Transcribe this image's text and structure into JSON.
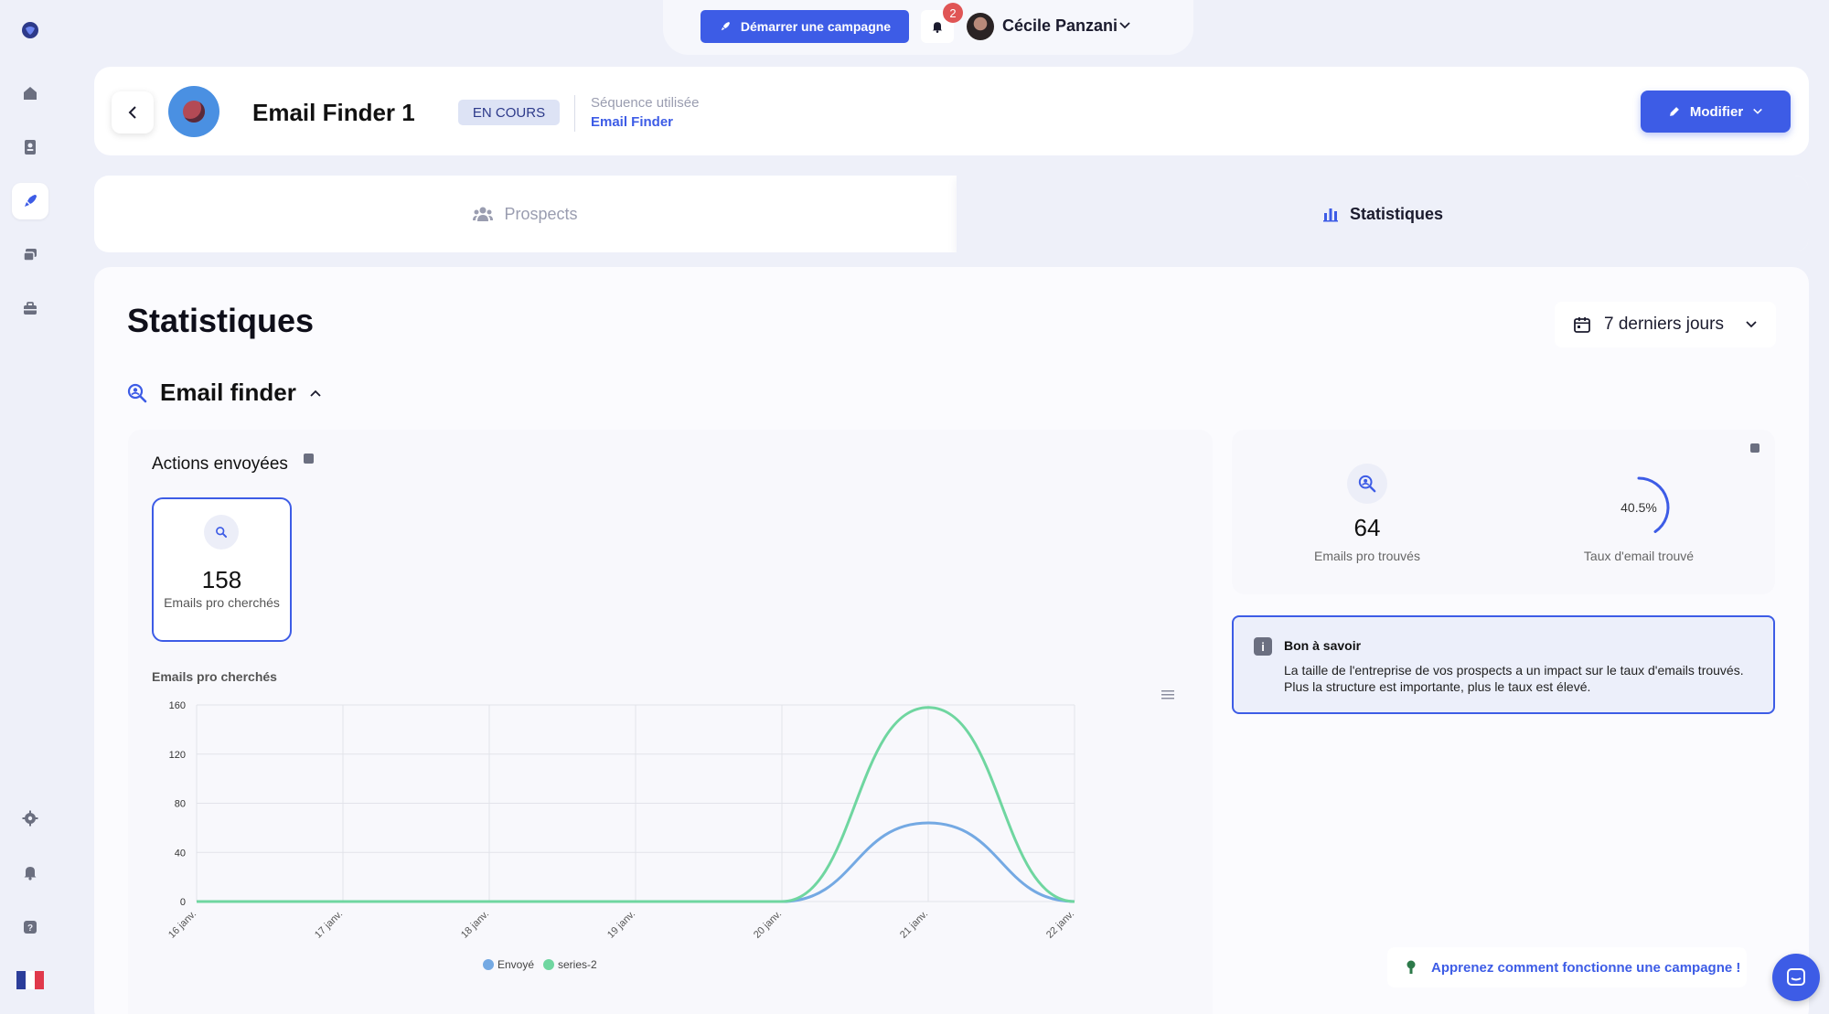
{
  "topbar": {
    "start_campaign_label": "Démarrer une campagne",
    "notification_count": "2",
    "user_name": "Cécile Panzani"
  },
  "sidebar": {
    "items": [
      {
        "icon": "logo-icon"
      },
      {
        "icon": "home-icon"
      },
      {
        "icon": "contacts-icon"
      },
      {
        "icon": "rocket-icon",
        "active": true
      },
      {
        "icon": "chat-icon"
      },
      {
        "icon": "briefcase-icon"
      },
      {
        "icon": "gear-icon"
      },
      {
        "icon": "bell-icon"
      },
      {
        "icon": "help-icon"
      },
      {
        "icon": "french-flag-icon"
      }
    ]
  },
  "header": {
    "title": "Email Finder 1",
    "status": "EN COURS",
    "sequence_label": "Séquence utilisée",
    "sequence_name": "Email Finder",
    "edit_label": "Modifier"
  },
  "tabs": [
    {
      "label": "Prospects",
      "active": false
    },
    {
      "label": "Statistiques",
      "active": true
    }
  ],
  "main": {
    "title": "Statistiques",
    "period": "7 derniers jours",
    "section_title": "Email finder",
    "actions_title": "Actions envoyées",
    "stat_box": {
      "value": "158",
      "label": "Emails pro cherchés"
    },
    "chart_label": "Emails pro cherchés"
  },
  "kpis": {
    "found_value": "64",
    "found_label": "Emails pro trouvés",
    "rate_value": "40.5%",
    "rate_label": "Taux d'email trouvé",
    "rate_fraction": 0.405
  },
  "tip": {
    "title": "Bon à savoir",
    "text": "La taille de l'entreprise de vos prospects a un impact sur le taux d'emails trouvés. Plus la structure est importante, plus le taux est élevé."
  },
  "learn_link": "Apprenez comment fonctionne une campagne !",
  "colors": {
    "accent": "#3d5ce6",
    "series_1": "#74a9e3",
    "series_2": "#6fd6a0"
  },
  "chart_data": {
    "type": "line",
    "categories": [
      "16 janv.",
      "17 janv.",
      "18 janv.",
      "19 janv.",
      "20 janv.",
      "21 janv.",
      "22 janv."
    ],
    "series": [
      {
        "name": "Envoyé",
        "values": [
          0,
          0,
          0,
          0,
          0,
          64,
          0
        ]
      },
      {
        "name": "series-2",
        "values": [
          0,
          0,
          0,
          0,
          0,
          158,
          0
        ]
      }
    ],
    "yticks": [
      0,
      40,
      80,
      120,
      160
    ],
    "ylim": [
      0,
      160
    ],
    "title": "",
    "xlabel": "",
    "ylabel": "",
    "legend": "bottom"
  }
}
